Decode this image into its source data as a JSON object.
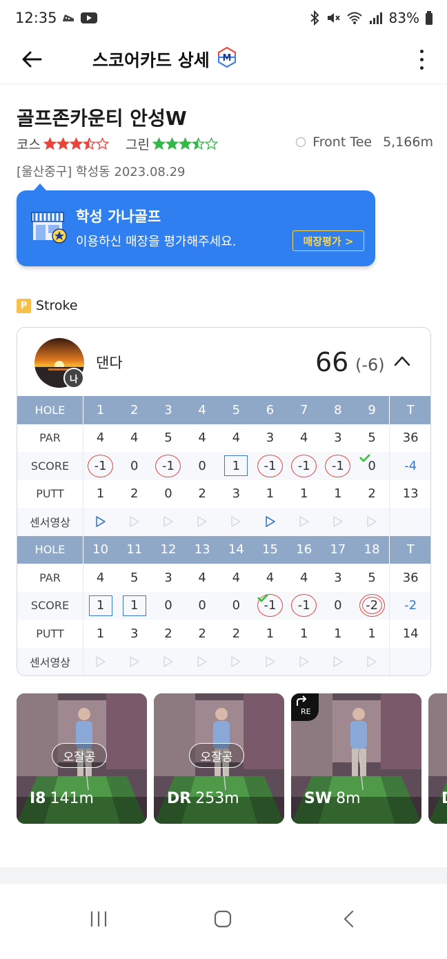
{
  "status_bar": {
    "time": "12:35",
    "battery": "83%"
  },
  "app_bar": {
    "title": "스코어카드 상세",
    "badge_letter": "M"
  },
  "course": {
    "name": "골프존카운티 안성W",
    "course_label": "코스",
    "course_stars": 3.5,
    "green_label": "그린",
    "green_stars": 3.5,
    "tee": "Front Tee",
    "length": "5,166m",
    "location": "[울산중구] 학성동 2023.08.29"
  },
  "colors": {
    "accent_blue": "#2f7ff0",
    "score_red": "#e0443e",
    "score_blue": "#3a78c9",
    "header": "#8fa8c8",
    "check_green": "#2fbf3a"
  },
  "promo": {
    "store": "학성 가나골프",
    "message": "이용하신 매장을 평가해주세요.",
    "button": "매장평가 >"
  },
  "mode": {
    "icon": "P",
    "label": "Stroke"
  },
  "player": {
    "name": "댄다",
    "me_badge": "나",
    "total": "66",
    "diff": "(-6)"
  },
  "scorecard": {
    "labels": {
      "hole": "HOLE",
      "par": "PAR",
      "score": "SCORE",
      "putt": "PUTT",
      "sensor": "센서영상",
      "total": "T"
    },
    "front": {
      "holes": [
        "1",
        "2",
        "3",
        "4",
        "5",
        "6",
        "7",
        "8",
        "9"
      ],
      "par": [
        "4",
        "4",
        "5",
        "4",
        "4",
        "3",
        "4",
        "3",
        "5"
      ],
      "score": [
        "-1",
        "0",
        "-1",
        "0",
        "1",
        "-1",
        "-1",
        "-1",
        "0"
      ],
      "score_style": [
        "circle",
        "plain",
        "circle",
        "plain",
        "box",
        "circle",
        "circle",
        "circle",
        "plain"
      ],
      "score_check": [
        false,
        false,
        false,
        false,
        false,
        false,
        false,
        false,
        true
      ],
      "putt": [
        "1",
        "2",
        "0",
        "2",
        "3",
        "1",
        "1",
        "1",
        "2"
      ],
      "video": [
        true,
        false,
        false,
        false,
        false,
        true,
        false,
        false,
        false
      ],
      "par_total": "36",
      "score_total": "-4",
      "putt_total": "13"
    },
    "back": {
      "holes": [
        "10",
        "11",
        "12",
        "13",
        "14",
        "15",
        "16",
        "17",
        "18"
      ],
      "par": [
        "4",
        "5",
        "3",
        "4",
        "4",
        "4",
        "4",
        "3",
        "5"
      ],
      "score": [
        "1",
        "1",
        "0",
        "0",
        "0",
        "-1",
        "-1",
        "0",
        "-2"
      ],
      "score_style": [
        "box",
        "box",
        "plain",
        "plain",
        "plain",
        "circle",
        "circle",
        "plain",
        "double"
      ],
      "score_check": [
        false,
        false,
        false,
        false,
        false,
        true,
        false,
        false,
        false
      ],
      "putt": [
        "1",
        "3",
        "2",
        "2",
        "2",
        "1",
        "1",
        "1",
        "1"
      ],
      "video": [
        false,
        false,
        false,
        false,
        false,
        false,
        false,
        false,
        false
      ],
      "par_total": "36",
      "score_total": "-2",
      "putt_total": "14"
    }
  },
  "shots": [
    {
      "tag": "오잘공",
      "club": "I8",
      "distance": "141m",
      "re": false
    },
    {
      "tag": "오잘공",
      "club": "DR",
      "distance": "253m",
      "re": false
    },
    {
      "tag": "",
      "club": "SW",
      "distance": "8m",
      "re": true,
      "re_label": "RE"
    },
    {
      "tag": "",
      "club": "D",
      "distance": "",
      "re": false
    }
  ]
}
